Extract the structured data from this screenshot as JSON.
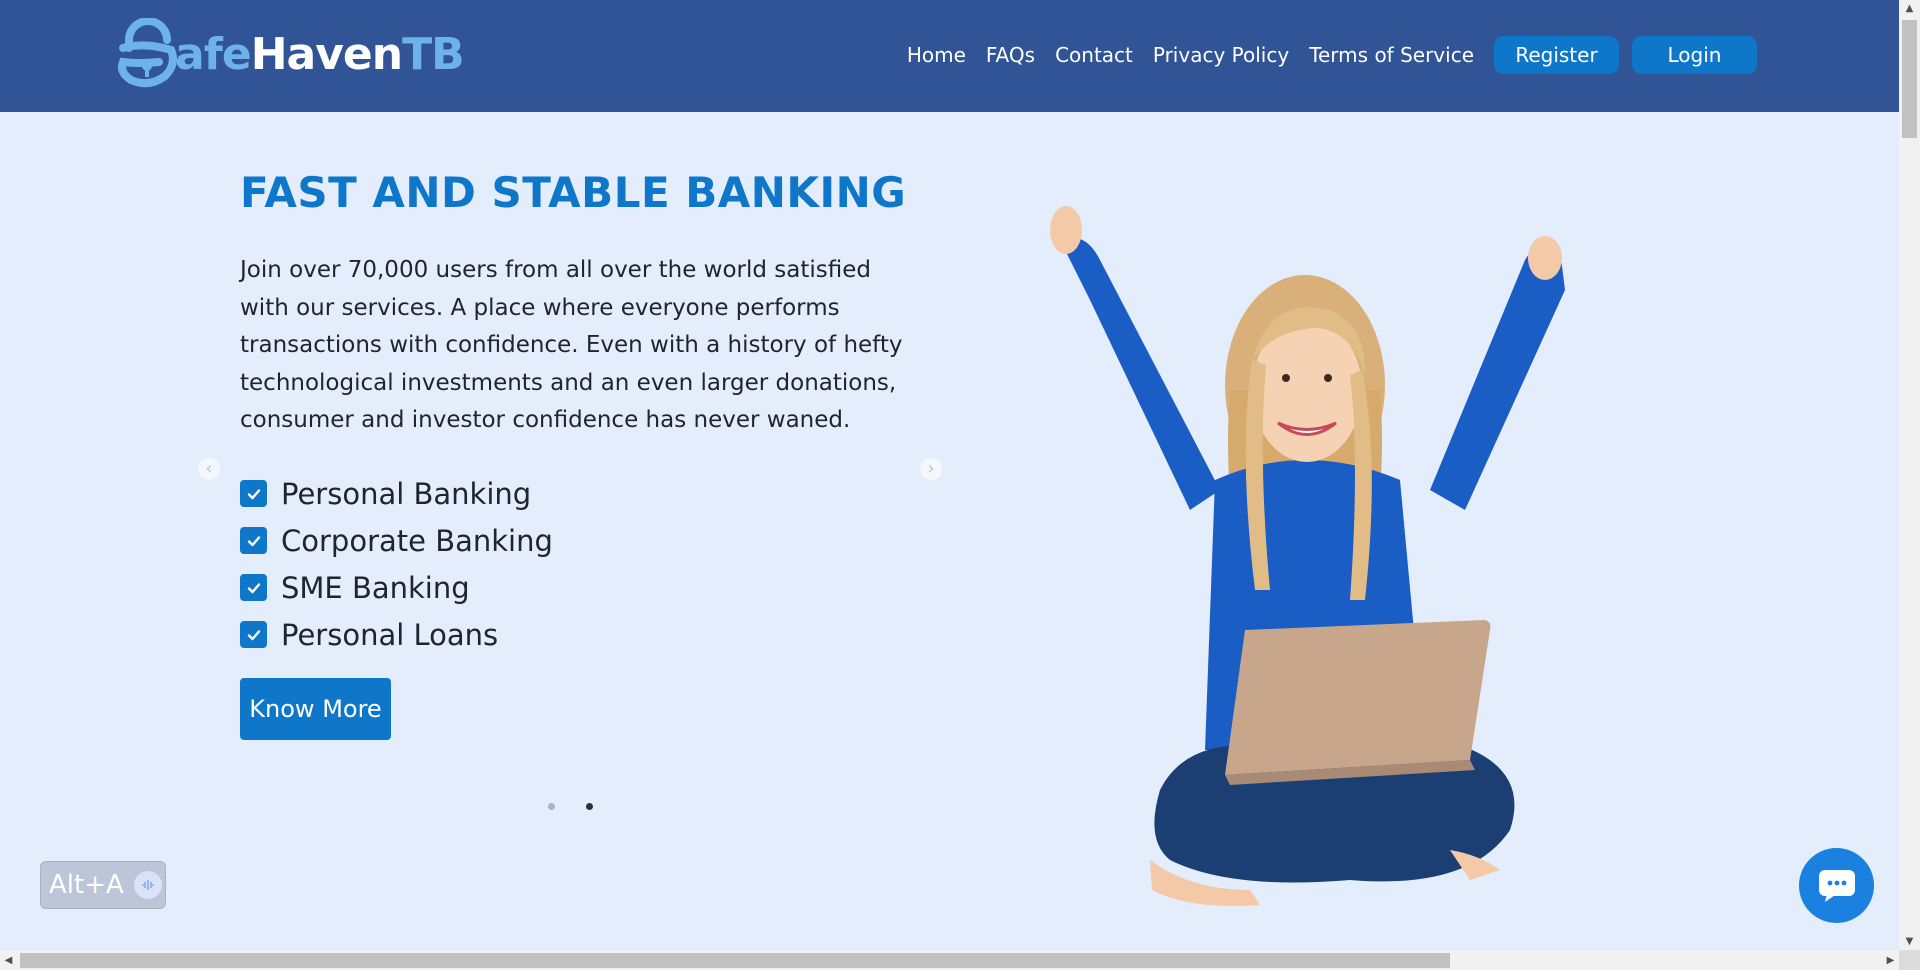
{
  "brand": {
    "safe": "afe",
    "haven": "Haven",
    "tb": "TB"
  },
  "nav": {
    "links": [
      "Home",
      "FAQs",
      "Contact",
      "Privacy Policy",
      "Terms of Service"
    ],
    "register_label": "Register",
    "login_label": "Login"
  },
  "hero": {
    "title": "FAST AND STABLE BANKING",
    "description": "Join over 70,000 users from all over the world satisfied with our services. A place where everyone performs transactions with confidence. Even with a history of hefty technological investments and an even larger donations, consumer and investor confidence has never waned.",
    "features": [
      "Personal Banking",
      "Corporate Banking",
      "SME Banking",
      "Personal Loans"
    ],
    "cta_label": "Know More"
  },
  "carousel": {
    "slides": 2,
    "active_slide": 2
  },
  "widgets": {
    "alt_shortcut": "Alt+A"
  },
  "colors": {
    "navbar": "#305496",
    "accent": "#0e77c9",
    "background": "#e3edfb"
  }
}
